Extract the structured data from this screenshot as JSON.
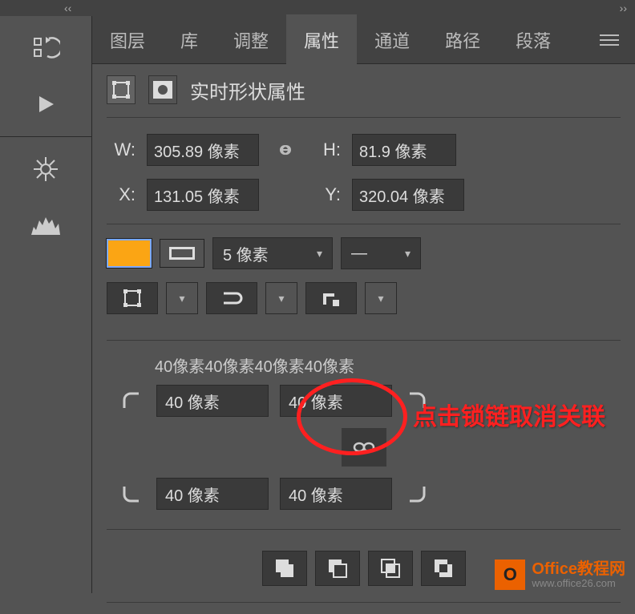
{
  "topbar": {
    "collapse_left": "‹‹",
    "collapse_right": "››"
  },
  "sidebar_tools": {
    "history": "历史",
    "actions": "动作",
    "navigator": "导航器",
    "histogram": "直方图"
  },
  "tabs": {
    "layers": "图层",
    "swatches": "库",
    "adjustments": "调整",
    "properties": "属性",
    "channels": "通道",
    "paths": "路径",
    "paragraph": "段落"
  },
  "header": {
    "title": "实时形状属性"
  },
  "dims": {
    "w_label": "W:",
    "w_value": "305.89 像素",
    "h_label": "H:",
    "h_value": "81.9 像素",
    "x_label": "X:",
    "x_value": "131.05 像素",
    "y_label": "Y:",
    "y_value": "320.04 像素"
  },
  "stroke": {
    "width_value": "5 像素",
    "style_dash": "—"
  },
  "radius": {
    "all": "40像素40像素40像素40像素",
    "tl": "40 像素",
    "tr": "40 像素",
    "bl": "40 像素",
    "br": "40 像素"
  },
  "annotation": "点击锁链取消关联",
  "watermark": {
    "title": "Office教程网",
    "url": "www.office26.com"
  }
}
